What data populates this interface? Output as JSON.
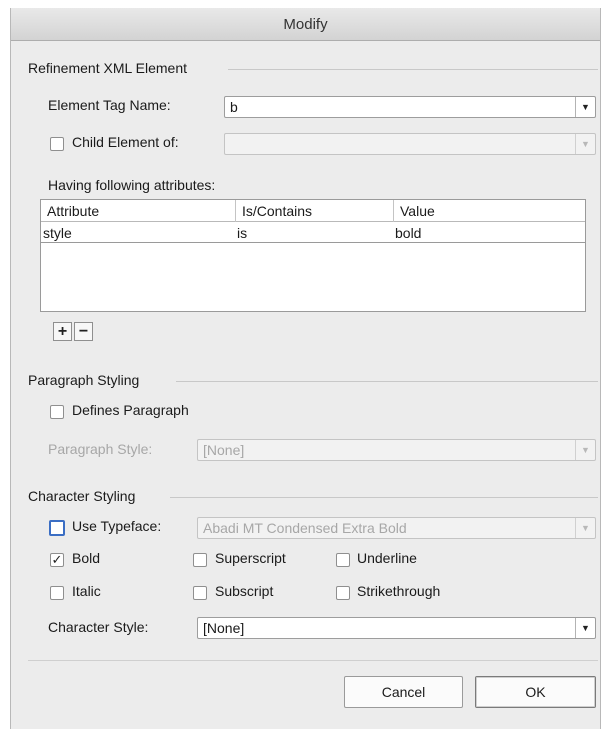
{
  "dialog": {
    "title": "Modify"
  },
  "refinement": {
    "section_title": "Refinement XML Element",
    "tag_label": "Element Tag Name:",
    "tag_value": "b",
    "child_of_label": "Child Element of:",
    "child_of_checked": false,
    "child_of_value": "",
    "attributes_label": "Having following attributes:",
    "columns": [
      "Attribute",
      "Is/Contains",
      "Value"
    ],
    "rows": [
      {
        "attribute": "style",
        "is_contains": "is",
        "value": "bold"
      }
    ],
    "add_label": "+",
    "remove_label": "−"
  },
  "paragraph": {
    "section_title": "Paragraph Styling",
    "defines_label": "Defines Paragraph",
    "defines_checked": false,
    "style_label": "Paragraph Style:",
    "style_value": "[None]"
  },
  "character": {
    "section_title": "Character Styling",
    "use_typeface_label": "Use Typeface:",
    "use_typeface_checked": false,
    "typeface_value": "Abadi MT Condensed Extra Bold",
    "bold_label": "Bold",
    "bold_checked": true,
    "superscript_label": "Superscript",
    "underline_label": "Underline",
    "italic_label": "Italic",
    "subscript_label": "Subscript",
    "strikethrough_label": "Strikethrough",
    "style_label": "Character Style:",
    "style_value": "[None]"
  },
  "buttons": {
    "cancel": "Cancel",
    "ok": "OK"
  },
  "icons": {
    "dropdown_arrow": "chevron-down-icon",
    "checkmark": "checkmark-icon"
  },
  "colors": {
    "focus_ring": "#3b6ec4",
    "dialog_bg": "#ececec"
  }
}
